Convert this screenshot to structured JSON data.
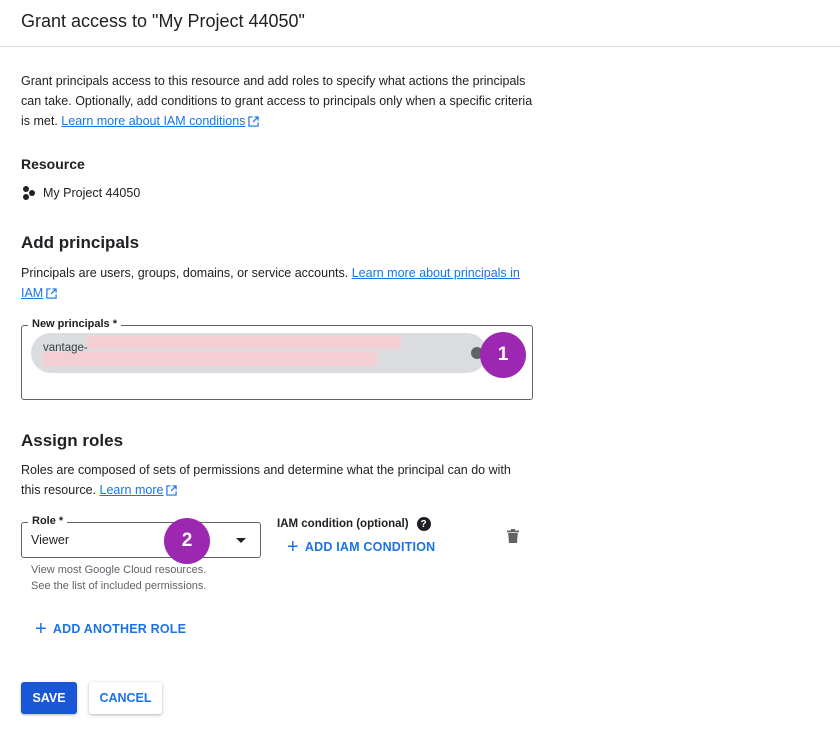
{
  "header": {
    "title": "Grant access to \"My Project 44050\""
  },
  "intro": {
    "text": "Grant principals access to this resource and add roles to specify what actions the principals can take. Optionally, add conditions to grant access to principals only when a specific criteria is met.",
    "link": "Learn more about IAM conditions"
  },
  "resource": {
    "heading": "Resource",
    "icon": "project-icon",
    "name": "My Project 44050"
  },
  "principals": {
    "heading": "Add principals",
    "description": "Principals are users, groups, domains, or service accounts.",
    "link": "Learn more about principals in IAM",
    "field_label": "New principals *",
    "chip_text": "vantage-"
  },
  "roles": {
    "heading": "Assign roles",
    "description": "Roles are composed of sets of permissions and determine what the principal can do with this resource.",
    "link": "Learn more",
    "role_label": "Role *",
    "role_value": "Viewer",
    "role_hint_line1": "View most Google Cloud resources.",
    "role_hint_line2": "See the list of included permissions.",
    "iam_condition_label": "IAM condition (optional)",
    "add_iam_condition": "ADD IAM CONDITION",
    "add_another_role": "ADD ANOTHER ROLE"
  },
  "annotations": {
    "badge1": "1",
    "badge2": "2",
    "badge_color": "#9c27b0"
  },
  "actions": {
    "save": "SAVE",
    "cancel": "CANCEL"
  },
  "colors": {
    "accent": "#1a73e8",
    "primary_button": "#1a57d6"
  }
}
